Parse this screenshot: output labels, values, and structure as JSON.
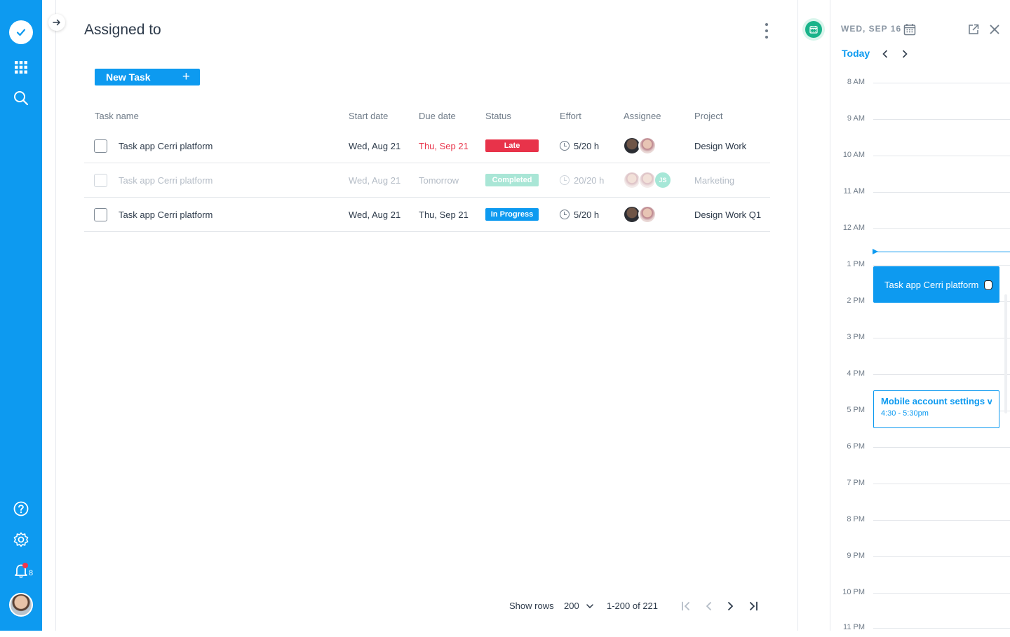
{
  "page": {
    "title": "Assigned to"
  },
  "toolbar": {
    "new_task_label": "New Task",
    "new_task_icon": "plus-icon"
  },
  "table": {
    "columns": [
      "Task name",
      "Start date",
      "Due date",
      "Status",
      "Effort",
      "Assignee",
      "Project"
    ],
    "rows": [
      {
        "task": "Task app Cerri platform",
        "start": "Wed, Aug 21",
        "due": "Thu, Sep 21",
        "status": "Late",
        "effort": "5/20 h",
        "project": "Design Work"
      },
      {
        "task": "Task app Cerri platform",
        "start": "Wed, Aug 21",
        "due": "Tomorrow",
        "status": "Completed",
        "effort": "20/20 h",
        "initials": "JS",
        "project": "Marketing"
      },
      {
        "task": "Task app Cerri platform",
        "start": "Wed, Aug 21",
        "due": "Thu, Sep 21",
        "status": "In Progress",
        "effort": "5/20 h",
        "project": "Design Work Q1"
      }
    ]
  },
  "status_colors": {
    "Late": "#e8334a",
    "Completed": "#a9e6d6",
    "In Progress": "#0d9af0",
    "due_late": "#e8334a"
  },
  "pagination": {
    "show_rows_label": "Show rows",
    "rows_value": "200",
    "range": "1-200 of 221"
  },
  "sidebar": {
    "notification_count": "8"
  },
  "calendar": {
    "date": "WED, SEP 16",
    "today_label": "Today",
    "hours": [
      "8 AM",
      "9 AM",
      "10 AM",
      "11 AM",
      "12 AM",
      "1 PM",
      "2 PM",
      "3 PM",
      "4 PM",
      "5 PM",
      "6 PM",
      "7 PM",
      "8 PM",
      "9 PM",
      "10 PM",
      "11 PM"
    ],
    "events": [
      {
        "title": "Task app Cerri platform"
      },
      {
        "title": "Mobile account settings vi...",
        "time": "4:30 - 5:30pm"
      }
    ]
  },
  "colors": {
    "brand": "#0d9af0",
    "calendar_accent": "#19b38a"
  }
}
